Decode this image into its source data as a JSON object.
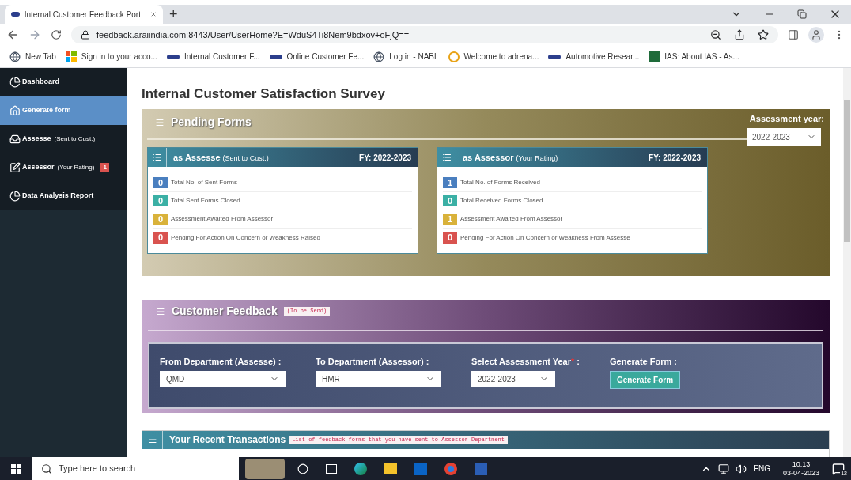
{
  "browser": {
    "tabs": [
      {
        "title": "Internal Customer Feedback Port",
        "selected": true
      }
    ],
    "new_tab": "+",
    "url": "feedback.araiindia.com:8443/User/UserHome?E=WduS4Ti8Nem9bdxov+oFjQ==",
    "bookmarks": [
      {
        "kind": "globe",
        "label": "New Tab"
      },
      {
        "kind": "squares",
        "label": "Sign in to your acco..."
      },
      {
        "kind": "arai",
        "label": "Internal Customer F..."
      },
      {
        "kind": "arai",
        "label": "Online Customer Fe..."
      },
      {
        "kind": "globe",
        "label": "Log in - NABL"
      },
      {
        "kind": "a",
        "label": "Welcome to adrena..."
      },
      {
        "kind": "arai",
        "label": "Automotive Resear..."
      },
      {
        "kind": "ias",
        "label": "IAS: About IAS - As..."
      }
    ]
  },
  "sidebar": {
    "items": [
      {
        "label": "Dashboard",
        "selected": false
      },
      {
        "label": "Generate form",
        "selected": true
      },
      {
        "label": "Assesse",
        "note": "(Sent to Cust.)",
        "selected": false
      },
      {
        "label": "Assessor",
        "note": "(Your Rating)",
        "badge": "1",
        "selected": false
      },
      {
        "label": "Data Analysis Report",
        "selected": false
      }
    ]
  },
  "page_title": "Internal Customer Satisfaction Survey",
  "pending": {
    "title": "Pending Forms",
    "year_label": "Assessment year:",
    "year_value": "2022-2023",
    "cards": [
      {
        "title": "as Assesse",
        "note": "(Sent to Cust.)",
        "fy": "FY: 2022-2023",
        "rows": [
          {
            "count": "0",
            "label": "Total No. of Sent Forms",
            "color": "#4a7fbf"
          },
          {
            "count": "0",
            "label": "Total Sent Forms Closed",
            "color": "#3bb0a5"
          },
          {
            "count": "0",
            "label": "Assessment Awaited From Assessor",
            "color": "#d9b23a"
          },
          {
            "count": "0",
            "label": "Pending For Action On Concern or Weakness Raised",
            "color": "#d9534f"
          }
        ]
      },
      {
        "title": "as Assessor",
        "note": "(Your Rating)",
        "fy": "FY: 2022-2023",
        "rows": [
          {
            "count": "1",
            "label": "Total No. of Forms Received",
            "color": "#4a7fbf"
          },
          {
            "count": "0",
            "label": "Total Received Forms Closed",
            "color": "#3bb0a5"
          },
          {
            "count": "1",
            "label": "Assessment Awaited From Assessor",
            "color": "#d9b23a"
          },
          {
            "count": "0",
            "label": "Pending For Action On Concern or Weakness From Assesse",
            "color": "#d9534f"
          }
        ]
      }
    ]
  },
  "feedback": {
    "title": "Customer Feedback",
    "tag": "(To be Send)",
    "fields": [
      {
        "kind": "select",
        "label": "From Department (Assesse) :",
        "value": "QMD"
      },
      {
        "kind": "select",
        "label": "To Department (Assessor) :",
        "value": "HMR"
      },
      {
        "kind": "select",
        "label": "Select Assessment Year",
        "value": "2022-2023",
        "required_mark": "*",
        "suffix": " :"
      },
      {
        "kind": "button",
        "label": "Generate Form :",
        "value": "Generate Form"
      }
    ]
  },
  "recent": {
    "title": "Your Recent Transactions",
    "tag": "List of feedback forms that you have sent to Assessor Department"
  },
  "taskbar": {
    "search_placeholder": "Type here to search",
    "language": "ENG",
    "time": "10:13",
    "date": "03-04-2023",
    "notifications": "12"
  }
}
